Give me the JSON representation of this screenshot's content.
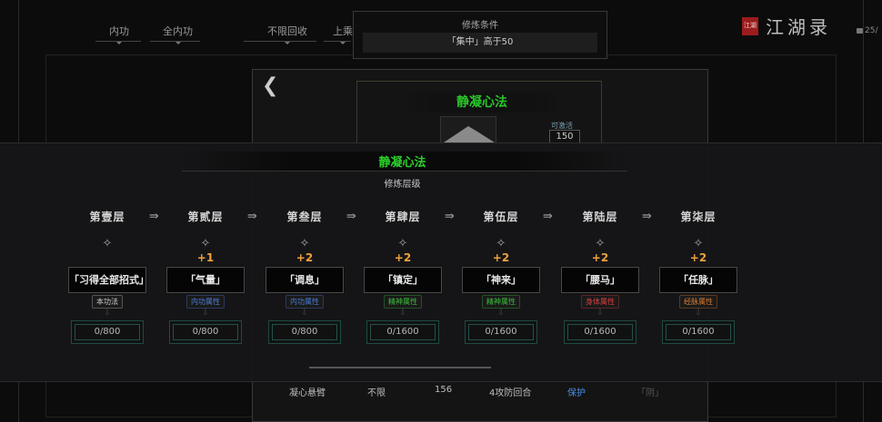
{
  "background": {
    "filters": [
      {
        "label": "内功"
      },
      {
        "label": "全内功"
      },
      {
        "label": "不限回收"
      },
      {
        "label": "上乘"
      }
    ],
    "brand": {
      "seal": "江湖",
      "title": "江湖录",
      "count": "25/"
    },
    "card_title": "静凝心法",
    "side_label": "可激活",
    "side_value": "150",
    "row": {
      "name": "凝心悬臂",
      "limit": "不限",
      "value": "156",
      "rounds": "4攻防回合",
      "effect": "保护",
      "extra": "「阴」"
    }
  },
  "condition": {
    "title": "修炼条件",
    "value": "「集中」高于50"
  },
  "panel": {
    "title": "静凝心法",
    "subtitle": "修炼层级",
    "layers": [
      {
        "name": "第壹层",
        "bonus": "",
        "attr": "「习得全部招式」",
        "tag": "本功法",
        "tag_color": "#cccccc",
        "progress": "0/800"
      },
      {
        "name": "第贰层",
        "bonus": "+1",
        "attr": "「气量」",
        "tag": "内功属性",
        "tag_color": "#4a7fd8",
        "progress": "0/800"
      },
      {
        "name": "第叁层",
        "bonus": "+2",
        "attr": "「调息」",
        "tag": "内功属性",
        "tag_color": "#4a7fd8",
        "progress": "0/800"
      },
      {
        "name": "第肆层",
        "bonus": "+2",
        "attr": "「镇定」",
        "tag": "精神属性",
        "tag_color": "#3cbf3c",
        "progress": "0/1600"
      },
      {
        "name": "第伍层",
        "bonus": "+2",
        "attr": "「神来」",
        "tag": "精神属性",
        "tag_color": "#3cbf3c",
        "progress": "0/1600"
      },
      {
        "name": "第陆层",
        "bonus": "+2",
        "attr": "「腰马」",
        "tag": "身体属性",
        "tag_color": "#d84040",
        "progress": "0/1600"
      },
      {
        "name": "第柒层",
        "bonus": "+2",
        "attr": "「任脉」",
        "tag": "经脉属性",
        "tag_color": "#d87a30",
        "progress": "0/1600"
      }
    ]
  }
}
